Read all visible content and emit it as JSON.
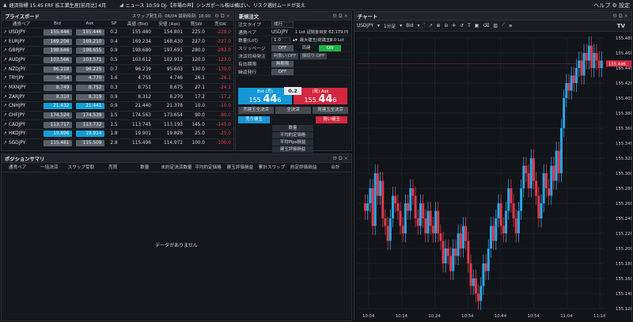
{
  "topbar": {
    "logo": "▲",
    "ticker": "経済指標 15:45 FRF 拡工業生産[前月比] 4月",
    "news_icon": "◢",
    "news": "ニュース 10:59 DJ-【市場の声】シンガポール株は横ばい、リスク選好ムードが支え",
    "help": "ヘルプ",
    "settings": "設定"
  },
  "priceboard": {
    "title": "プライスボード",
    "swap_info": "スワップ発生日: 06/04  最新時刻: 18:00",
    "columns": [
      "通貨ペア",
      "Bid",
      "Ask",
      "SP",
      "高値 (Bid)",
      "安値 (Ask)",
      "買SW",
      "売SW"
    ],
    "rows": [
      {
        "pair": "USDJPY",
        "bid": "155.446",
        "ask": "155.446",
        "sp": "0.2",
        "high": "155.480",
        "low": "154.801",
        "bsw": "225.0",
        "ssw": "-228.0",
        "up": false
      },
      {
        "pair": "EURJPY",
        "bid": "169.206",
        "ask": "169.210",
        "sp": "0.4",
        "high": "169.234",
        "low": "168.430",
        "bsw": "227.0",
        "ssw": "-227.0",
        "up": false
      },
      {
        "pair": "GBPJPY",
        "bid": "198.646",
        "ask": "198.655",
        "sp": "0.9",
        "high": "198.680",
        "low": "197.691",
        "bsw": "280.0",
        "ssw": "-283.0",
        "up": false
      },
      {
        "pair": "AUDJPY",
        "bid": "103.566",
        "ask": "103.571",
        "sp": "0.5",
        "high": "103.612",
        "low": "102.912",
        "bsw": "120.0",
        "ssw": "-123.0",
        "up": false
      },
      {
        "pair": "NZDJPY",
        "bid": "96.218",
        "ask": "96.225",
        "sp": "0.7",
        "high": "96.239",
        "low": "95.603",
        "bsw": "130.0",
        "ssw": "-130.0",
        "up": false
      },
      {
        "pair": "TRYJPY",
        "bid": "4.754",
        "ask": "4.770",
        "sp": "1.6",
        "high": "4.755",
        "low": "4.746",
        "bsw": "26.1",
        "ssw": "-26.1",
        "up": false
      },
      {
        "pair": "MXNJPY",
        "bid": "8.749",
        "ask": "8.752",
        "sp": "0.3",
        "high": "8.751",
        "low": "8.675",
        "bsw": "27.1",
        "ssw": "-24.1",
        "up": false
      },
      {
        "pair": "ZARJPY",
        "bid": "8.310",
        "ask": "8.319",
        "sp": "0.9",
        "high": "8.312",
        "low": "8.270",
        "bsw": "17.2",
        "ssw": "-17.2",
        "up": false
      },
      {
        "pair": "CNHJPY",
        "bid": "21.432",
        "ask": "21.441",
        "sp": "0.9",
        "high": "21.440",
        "low": "21.378",
        "bsw": "10.0",
        "ssw": "-10.0",
        "up": true
      },
      {
        "pair": "CHFJPY",
        "bid": "174.524",
        "ask": "174.539",
        "sp": "1.5",
        "high": "174.563",
        "low": "173.654",
        "bsw": "90.0",
        "ssw": "-90.0",
        "up": false
      },
      {
        "pair": "CADJPY",
        "bid": "113.717",
        "ask": "113.732",
        "sp": "1.5",
        "high": "113.745",
        "low": "113.193",
        "bsw": "145.0",
        "ssw": "-145.0",
        "up": false
      },
      {
        "pair": "HKDJPY",
        "bid": "19.896",
        "ask": "19.914",
        "sp": "1.8",
        "high": "19.901",
        "low": "19.826",
        "bsw": "25.0",
        "ssw": "-25.0",
        "up": true
      },
      {
        "pair": "SGDJPY",
        "bid": "115.481",
        "ask": "115.509",
        "sp": "2.8",
        "high": "115.496",
        "low": "114.972",
        "bsw": "100.0",
        "ssw": "-100.0",
        "up": false
      }
    ]
  },
  "order": {
    "title": "新規注文",
    "type_label": "注文タイプ",
    "type_value": "成行",
    "pair_label": "通貨ペア",
    "pair_value": "USDJPY",
    "lot_info": "1 Lot 証拠金目安  62,179 円",
    "qty_label": "数量(Lot)",
    "qty_value": "1.0",
    "max_label": "最大建玉(総建玉)",
    "max_value": "0.0 Lot",
    "slip_label": "スリッページ",
    "slip_off": "OFF",
    "slip_mid": "両建",
    "slip_on": "ON",
    "settle_label": "決済同時発注",
    "settle_a": "利食い:OFF",
    "settle_b": "損切り:OFF",
    "expiry_label": "有効期限",
    "expiry_value": "無期限",
    "recur_label": "繰返発行",
    "recur_value": "OFF",
    "bid_label": "Bid (売)",
    "bid_pre": "155.",
    "bid_big": "44",
    "bid_post": "6",
    "spread": "0.2",
    "ask_label": "(買) Ask",
    "ask_pre": "155.",
    "ask_big": "44",
    "ask_post": "6",
    "btn_sell_settle": "売建玉全決済",
    "btn_all_settle": "全決済",
    "btn_buy_settle": "買建玉全決済",
    "btn_sell": "売り建玉",
    "btn_buy": "買い建玉",
    "stats": [
      "数量",
      "平均約定価格",
      "平均Pips損益",
      "建玉評価損益"
    ]
  },
  "position": {
    "title": "ポジションサマリ",
    "columns": [
      "通貨ペア",
      "一括決済",
      "スワップ受取",
      "売買",
      "数量",
      "未約定決済数量",
      "平均約定価格",
      "建玉評価損益",
      "累計スワップ",
      "約定評価損益",
      "合計"
    ],
    "empty": "データがありません"
  },
  "chart": {
    "title": "チャート",
    "pair": "USDJPY",
    "timeframe": "1分足",
    "side": "Bid",
    "last_price": "155.446",
    "price_ticks": [
      "155.480",
      "155.460",
      "155.440",
      "155.420",
      "155.400",
      "155.380",
      "155.360",
      "155.340",
      "155.320",
      "155.300",
      "155.280",
      "155.260",
      "155.240",
      "155.220",
      "155.200",
      "155.180",
      "155.160",
      "155.140",
      "155.120"
    ],
    "time_ticks": [
      "10:04",
      "10:14",
      "10:24",
      "10:34",
      "10:44",
      "10:54",
      "11:04",
      "11:14"
    ],
    "logo": "TV"
  },
  "colors": {
    "bull": "#2aa4e6",
    "bear": "#e0384b",
    "accent": "#1596d6"
  },
  "chart_data": {
    "type": "candlestick",
    "x": [
      "10:04",
      "10:14",
      "10:24",
      "10:34",
      "10:44",
      "10:54",
      "11:04",
      "11:14"
    ],
    "ylim": [
      155.12,
      155.48
    ],
    "close": [
      155.25,
      155.26,
      155.28,
      155.23,
      155.3,
      155.27,
      155.29,
      155.24,
      155.23,
      155.21,
      155.24,
      155.27,
      155.26,
      155.25,
      155.23,
      155.22,
      155.26,
      155.25,
      155.28,
      155.27,
      155.24,
      155.23,
      155.26,
      155.24,
      155.22,
      155.25,
      155.23,
      155.22,
      155.25,
      155.22,
      155.21,
      155.18,
      155.2,
      155.19,
      155.17,
      155.2,
      155.19,
      155.22,
      155.2,
      155.23,
      155.21,
      155.18,
      155.15,
      155.16,
      155.14,
      155.13,
      155.15,
      155.18,
      155.17,
      155.2,
      155.23,
      155.21,
      155.24,
      155.26,
      155.23,
      155.22,
      155.25,
      155.28,
      155.26,
      155.24,
      155.22,
      155.25,
      155.28,
      155.31,
      155.3,
      155.28,
      155.32,
      155.29,
      155.27,
      155.24,
      155.26,
      155.3,
      155.28,
      155.27,
      155.31,
      155.29,
      155.33,
      155.3,
      155.36,
      155.4,
      155.42,
      155.41,
      155.43,
      155.42,
      155.44,
      155.45,
      155.43,
      155.46,
      155.45,
      155.47,
      155.44,
      155.46,
      155.45,
      155.44,
      155.45
    ],
    "open": [
      155.26,
      155.25,
      155.26,
      155.28,
      155.23,
      155.3,
      155.27,
      155.29,
      155.24,
      155.23,
      155.21,
      155.24,
      155.27,
      155.26,
      155.25,
      155.23,
      155.22,
      155.26,
      155.25,
      155.28,
      155.27,
      155.24,
      155.23,
      155.26,
      155.24,
      155.22,
      155.25,
      155.23,
      155.22,
      155.25,
      155.22,
      155.21,
      155.18,
      155.2,
      155.19,
      155.17,
      155.2,
      155.19,
      155.22,
      155.2,
      155.23,
      155.21,
      155.18,
      155.15,
      155.16,
      155.14,
      155.13,
      155.15,
      155.18,
      155.17,
      155.2,
      155.23,
      155.21,
      155.24,
      155.26,
      155.23,
      155.22,
      155.25,
      155.28,
      155.26,
      155.24,
      155.22,
      155.25,
      155.28,
      155.31,
      155.3,
      155.28,
      155.32,
      155.29,
      155.27,
      155.24,
      155.26,
      155.3,
      155.28,
      155.27,
      155.31,
      155.29,
      155.33,
      155.3,
      155.36,
      155.4,
      155.42,
      155.41,
      155.43,
      155.42,
      155.44,
      155.45,
      155.43,
      155.46,
      155.45,
      155.47,
      155.44,
      155.46,
      155.45,
      155.44
    ]
  }
}
